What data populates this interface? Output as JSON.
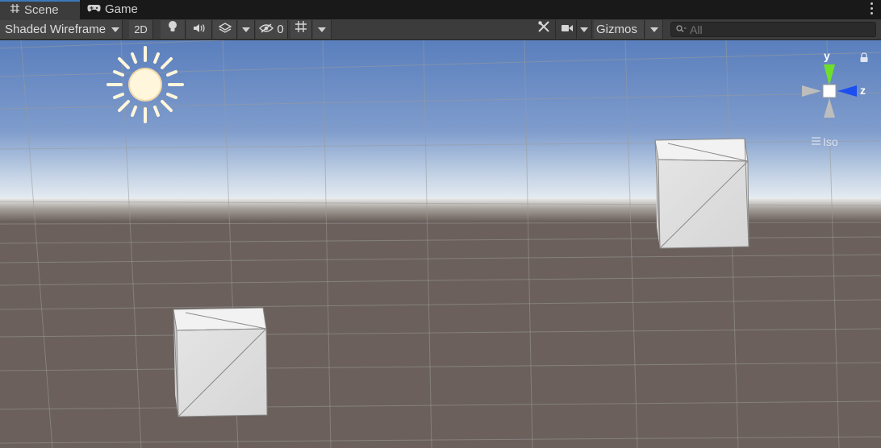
{
  "tabs": [
    {
      "label": "Scene",
      "icon": "grid-hash-icon",
      "active": true
    },
    {
      "label": "Game",
      "icon": "gamepad-icon",
      "active": false
    }
  ],
  "toolbar": {
    "draw_mode": "Shaded Wireframe",
    "mode_2d": "2D",
    "hidden_count": "0",
    "gizmos_label": "Gizmos",
    "search_placeholder": "All"
  },
  "gizmo": {
    "axis_y": "y",
    "axis_z": "z",
    "projection_label": "Iso"
  },
  "colors": {
    "sky_top": "#5a7fbd",
    "sky_horizon": "#e8edf2",
    "ground": "#6b605c",
    "axis_y": "#6ee02a",
    "axis_z": "#1d4ef0",
    "active_tab_accent": "#3a79bb"
  }
}
